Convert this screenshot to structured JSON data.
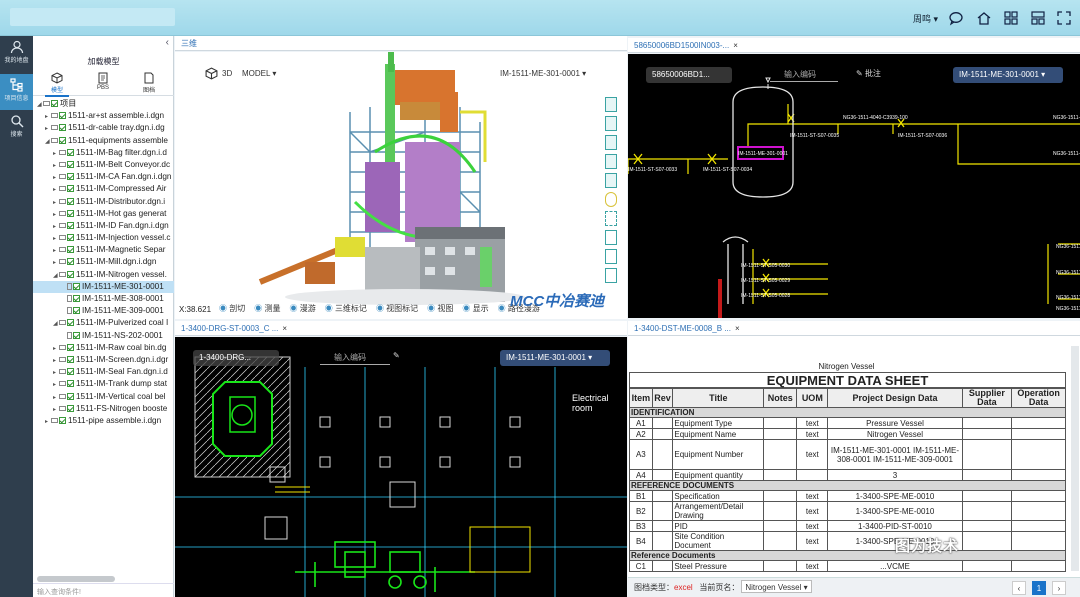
{
  "topbar": {
    "user": "周鸣 ▾"
  },
  "leftnav": [
    {
      "label": "我的地盘"
    },
    {
      "label": "项目信息"
    },
    {
      "label": "搜索"
    }
  ],
  "tree": {
    "title": "加载模型",
    "tabs": [
      "模型",
      "PBS",
      "图档"
    ],
    "items": [
      {
        "text": "项目",
        "depth": 0,
        "open": true,
        "type": "folder"
      },
      {
        "text": "1511-ar+st assemble.i.dgn",
        "depth": 1,
        "type": "folder"
      },
      {
        "text": "1511-dr-cable tray.dgn.i.dg",
        "depth": 1,
        "type": "folder"
      },
      {
        "text": "1511-equipments assemble",
        "depth": 1,
        "open": true,
        "type": "folder"
      },
      {
        "text": "1511-IM-Bag filter.dgn.i.d",
        "depth": 2,
        "type": "folder"
      },
      {
        "text": "1511-IM-Belt Conveyor.dc",
        "depth": 2,
        "type": "folder"
      },
      {
        "text": "1511-IM-CA Fan.dgn.i.dgn",
        "depth": 2,
        "type": "folder"
      },
      {
        "text": "1511-IM-Compressed Air",
        "depth": 2,
        "type": "folder"
      },
      {
        "text": "1511-IM-Distributor.dgn.i",
        "depth": 2,
        "type": "folder"
      },
      {
        "text": "1511-IM-Hot gas generat",
        "depth": 2,
        "type": "folder"
      },
      {
        "text": "1511-IM-ID Fan.dgn.i.dgn",
        "depth": 2,
        "type": "folder"
      },
      {
        "text": "1511-IM-Injection vessel.c",
        "depth": 2,
        "type": "folder"
      },
      {
        "text": "1511-IM-Magnetic Separ",
        "depth": 2,
        "type": "folder"
      },
      {
        "text": "1511-IM-Mill.dgn.i.dgn",
        "depth": 2,
        "type": "folder"
      },
      {
        "text": "1511-IM-Nitrogen vessel.",
        "depth": 2,
        "open": true,
        "type": "folder"
      },
      {
        "text": "IM-1511-ME-301-0001",
        "depth": 3,
        "type": "file",
        "selected": true
      },
      {
        "text": "IM-1511-ME-308-0001",
        "depth": 3,
        "type": "file"
      },
      {
        "text": "IM-1511-ME-309-0001",
        "depth": 3,
        "type": "file"
      },
      {
        "text": "1511-IM-Pulverized coal I",
        "depth": 2,
        "open": true,
        "type": "folder"
      },
      {
        "text": "IM-1511-NS-202-0001",
        "depth": 3,
        "type": "file"
      },
      {
        "text": "1511-IM-Raw coal bin.dg",
        "depth": 2,
        "type": "folder"
      },
      {
        "text": "1511-IM-Screen.dgn.i.dgr",
        "depth": 2,
        "type": "folder"
      },
      {
        "text": "1511-IM-Seal Fan.dgn.i.d",
        "depth": 2,
        "type": "folder"
      },
      {
        "text": "1511-IM-Trank dump stat",
        "depth": 2,
        "type": "folder"
      },
      {
        "text": "1511-IM-Vertical coal bel",
        "depth": 2,
        "type": "folder"
      },
      {
        "text": "1511-FS-Nitrogen booste",
        "depth": 2,
        "type": "folder"
      },
      {
        "text": "1511-pipe assemble.i.dgn",
        "depth": 1,
        "type": "folder"
      }
    ],
    "search_placeholder": "输入查询条件!"
  },
  "panel3d": {
    "tab": "三维",
    "mode_label": "3D",
    "model_label": "MODEL",
    "code": "IM-1511-ME-301-0001",
    "coord": "X:38.621",
    "toolbar": [
      "剖切",
      "测量",
      "漫游",
      "三维标记",
      "视图标记",
      "视图",
      "显示",
      "路径漫游"
    ],
    "logo": "MCC中冶赛迪"
  },
  "panelPid": {
    "tab": "58650006BD1500IN003-...",
    "doc_pill": "58650006BD1...",
    "search_placeholder": "输入编码",
    "annotate": "批注",
    "code": "IM-1511-ME-301-0001",
    "labels": [
      "NG36-1511-4040-C3939-100",
      "IM-1511-ST-S07-0036",
      "IM-1511-ST-S07-0035",
      "IM-1511-ME-301-0001",
      "IM-1511-ST-S07-0034",
      "IM-1511-ST-S07-0033",
      "NG36-1511-",
      "NG36-1511-",
      "NG36-1511-",
      "IM-1511-ST-S05-0030",
      "NG36-1511-",
      "IM-1511-ST-S05-0029",
      "NG36-1511-",
      "IM-1511-ST-S05-0028",
      "NG36-1511-"
    ]
  },
  "panelDrg": {
    "tab": "1-3400-DRG-ST-0003_C ...",
    "doc_pill": "1-3400-DRG...",
    "search_placeholder": "输入编码",
    "code": "IM-1511-ME-301-0001",
    "room": "Electrical room"
  },
  "panelSheet": {
    "tab": "1-3400-DST-ME-0008_B ...",
    "subtitle": "Nitrogen Vessel",
    "title": "EQUIPMENT DATA SHEET",
    "headers": [
      "Item",
      "Rev",
      "Title",
      "Notes",
      "UOM",
      "Project Design Data",
      "Supplier Data",
      "Operation Data"
    ],
    "sections": [
      {
        "name": "IDENTIFICATION",
        "rows": [
          {
            "item": "A1",
            "title": "Equipment Type",
            "uom": "text",
            "design": "Pressure Vessel"
          },
          {
            "item": "A2",
            "title": "Equipment Name",
            "uom": "text",
            "design": "Nitrogen Vessel"
          },
          {
            "item": "A3",
            "title": "Equipment Number",
            "uom": "text",
            "design": "IM-1511-ME-301-0001 IM-1511-ME-308-0001 IM-1511-ME-309-0001"
          },
          {
            "item": "A4",
            "title": "Equipment quantity",
            "uom": "",
            "design": "3"
          }
        ]
      },
      {
        "name": "REFERENCE DOCUMENTS",
        "rows": [
          {
            "item": "B1",
            "title": "Specification",
            "uom": "text",
            "design": "1-3400-SPE-ME-0010"
          },
          {
            "item": "B2",
            "title": "Arrangement/Detail Drawing",
            "uom": "text",
            "design": "1-3400-SPE-ME-0010"
          },
          {
            "item": "B3",
            "title": "PID",
            "uom": "text",
            "design": "1-3400-PID-ST-0010"
          },
          {
            "item": "B4",
            "title": "Site Condition Document",
            "uom": "text",
            "design": "1-3400-SPE-ME-0010"
          }
        ]
      },
      {
        "name": "Reference Documents",
        "rows": [
          {
            "item": "C1",
            "title": "Steel Pressure",
            "uom": "text",
            "design": "...VCME"
          }
        ]
      }
    ],
    "footer": {
      "type_label": "图档类型：",
      "type_value": "excel",
      "page_label": "当前页名：",
      "page_value": "Nitrogen Vessel ▾",
      "page": "1"
    }
  },
  "watermark": "图为技术",
  "colors": {
    "accent": "#1a73c9",
    "cad_bg": "#000000",
    "pid_line": "#f2e500",
    "pid_vessel": "#d012d0",
    "cad_green": "#19e619"
  }
}
